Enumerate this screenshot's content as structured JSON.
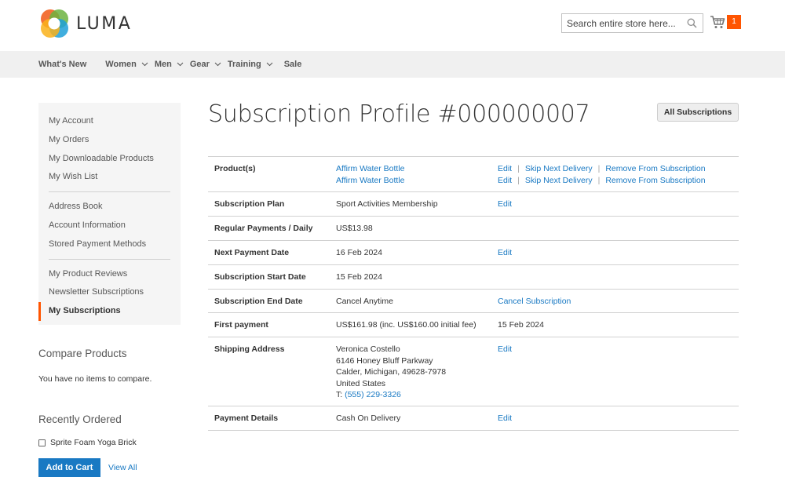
{
  "brand": {
    "name": "LUMA"
  },
  "search": {
    "placeholder": "Search entire store here..."
  },
  "cart": {
    "count": "1"
  },
  "nav": {
    "items": [
      {
        "label": "What's New",
        "dropdown": false
      },
      {
        "label": "Women",
        "dropdown": true
      },
      {
        "label": "Men",
        "dropdown": true
      },
      {
        "label": "Gear",
        "dropdown": true
      },
      {
        "label": "Training",
        "dropdown": true
      },
      {
        "label": "Sale",
        "dropdown": false
      }
    ]
  },
  "sidebar": {
    "groups": [
      [
        "My Account",
        "My Orders",
        "My Downloadable Products",
        "My Wish List"
      ],
      [
        "Address Book",
        "Account Information",
        "Stored Payment Methods"
      ],
      [
        "My Product Reviews",
        "Newsletter Subscriptions",
        "My Subscriptions"
      ]
    ],
    "active": "My Subscriptions"
  },
  "compare": {
    "title": "Compare Products",
    "empty_text": "You have no items to compare."
  },
  "recent": {
    "title": "Recently Ordered",
    "items": [
      "Sprite Foam Yoga Brick"
    ],
    "add_to_cart": "Add to Cart",
    "view_all": "View All"
  },
  "page": {
    "title": "Subscription Profile #000000007",
    "all_subscriptions_button": "All Subscriptions"
  },
  "profile": {
    "products_label": "Product(s)",
    "products": [
      {
        "name": "Affirm Water Bottle",
        "edit": "Edit",
        "skip": "Skip Next Delivery",
        "remove": "Remove From Subscription"
      },
      {
        "name": "Affirm Water Bottle",
        "edit": "Edit",
        "skip": "Skip Next Delivery",
        "remove": "Remove From Subscription"
      }
    ],
    "plan": {
      "label": "Subscription Plan",
      "value": "Sport Activities Membership",
      "action": "Edit"
    },
    "regular": {
      "label": "Regular Payments / Daily",
      "value": "US$13.98"
    },
    "next_payment": {
      "label": "Next Payment Date",
      "value": "16 Feb 2024",
      "action": "Edit"
    },
    "start": {
      "label": "Subscription Start Date",
      "value": "15 Feb 2024"
    },
    "end": {
      "label": "Subscription End Date",
      "value": "Cancel Anytime",
      "action": "Cancel Subscription"
    },
    "first_payment": {
      "label": "First payment",
      "value": "US$161.98 (inc. US$160.00 initial fee)",
      "date": "15 Feb 2024"
    },
    "shipping": {
      "label": "Shipping Address",
      "name": "Veronica Costello",
      "street": "6146 Honey Bluff Parkway",
      "city_line": "Calder, Michigan, 49628-7978",
      "country": "United States",
      "phone_prefix": "T: ",
      "phone": "(555) 229-3326",
      "action": "Edit"
    },
    "payment": {
      "label": "Payment Details",
      "value": "Cash On Delivery",
      "action": "Edit"
    }
  },
  "colors": {
    "accent": "#ff5501",
    "link": "#1979c3",
    "nav_bg": "#f0f0f0",
    "sidebar_bg": "#f5f5f5"
  }
}
